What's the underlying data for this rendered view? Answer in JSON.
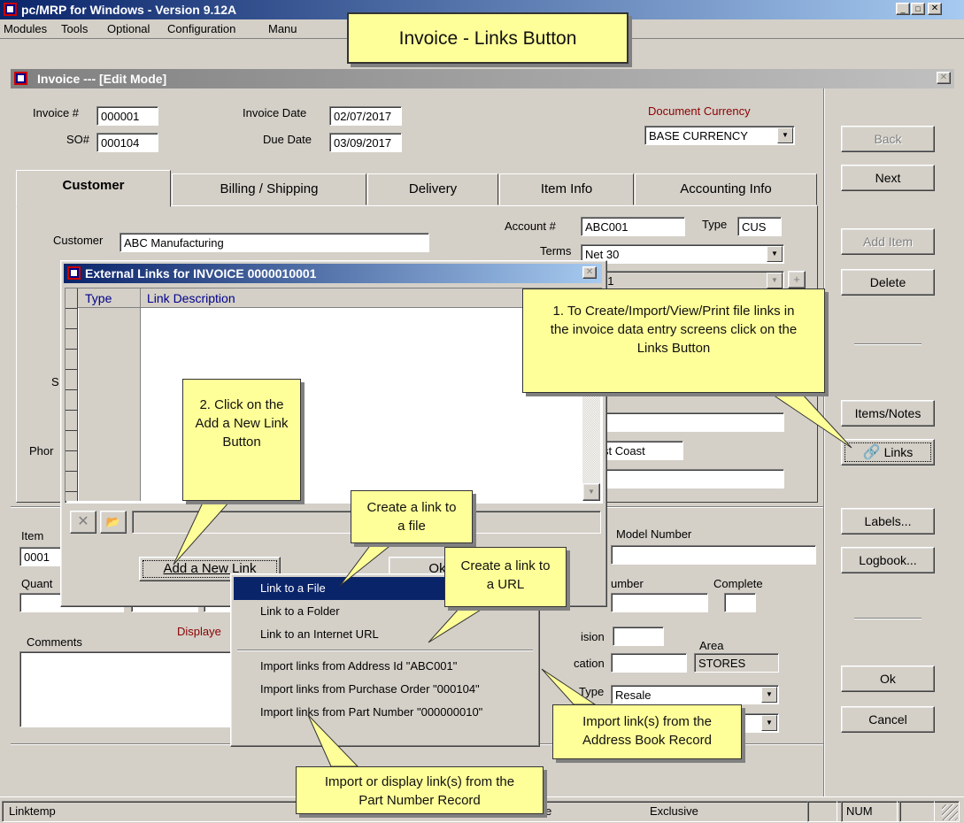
{
  "app": {
    "title": "pc/MRP for Windows - Version 9.12A"
  },
  "menubar": [
    "Modules",
    "Tools",
    "Optional",
    "Configuration",
    "Manu"
  ],
  "invoice": {
    "window_title": "Invoice --- [Edit Mode]",
    "invoice_no_label": "Invoice #",
    "invoice_no": "000001",
    "so_label": "SO#",
    "so_no": "000104",
    "invoice_date_label": "Invoice Date",
    "invoice_date": "02/07/2017",
    "due_date_label": "Due Date",
    "due_date": "03/09/2017",
    "currency_label": "Document Currency",
    "currency": "BASE CURRENCY",
    "tabs": [
      "Customer",
      "Billing / Shipping",
      "Delivery",
      "Item Info",
      "Accounting Info"
    ],
    "customer_label": "Customer",
    "customer": "ABC Manufacturing",
    "account_label": "Account #",
    "account": "ABC001",
    "type_label": "Type",
    "type": "CUS",
    "terms_label": "Terms",
    "terms": "Net 30",
    "zone_frag": "one 1",
    "coast_frag": "st Coast",
    "s_frag": "S",
    "phone_frag": "Phor",
    "item_label": "Item",
    "item_val": "0001",
    "quant_label": "Quant",
    "model_label": "Model Number",
    "number_label": "umber",
    "complete_label": "Complete",
    "comments_label": "Comments",
    "displayed_frag": "Displaye",
    "vision_label": "ision",
    "area_label": "Area",
    "area": "STORES",
    "cation_label": "cation",
    "type2_label": "Type",
    "type2": "Resale"
  },
  "buttons": {
    "back": "Back",
    "next": "Next",
    "add_item": "Add Item",
    "delete": "Delete",
    "items_notes": "Items/Notes",
    "links": "Links",
    "labels": "Labels...",
    "logbook": "Logbook...",
    "ok": "Ok",
    "cancel": "Cancel"
  },
  "links_dialog": {
    "title": "External Links for INVOICE 0000010001",
    "col_type": "Type",
    "col_desc": "Link Description",
    "add_btn": "Add a New Link",
    "ok_frag": "Ok"
  },
  "context_menu": [
    "Link to a File",
    "Link to a Folder",
    "Link to an Internet URL",
    "Import links from Address Id \"ABC001\"",
    "Import links from Purchase Order \"000104\"",
    "Import links from Part Number \"000000010\""
  ],
  "statusbar": {
    "left": "Linktemp",
    "mode_frag": "e",
    "exclusive": "Exclusive",
    "num": "NUM"
  },
  "callouts": {
    "title": "Invoice - Links Button",
    "step1": "1. To Create/Import/View/Print file links in the invoice data entry screens click on the Links Button",
    "step2": "2. Click on the Add a New Link Button",
    "file": "Create a link to a file",
    "url": "Create a link to a URL",
    "address": "Import link(s) from the Address Book Record",
    "part": "Import or display link(s) from the Part Number Record"
  },
  "colors": {
    "titlebar": "#0a246a",
    "menu_highlight": "#0a246a",
    "callout": "#ffff99",
    "currency_label": "#8b0000",
    "grid_header": "#00008b"
  }
}
